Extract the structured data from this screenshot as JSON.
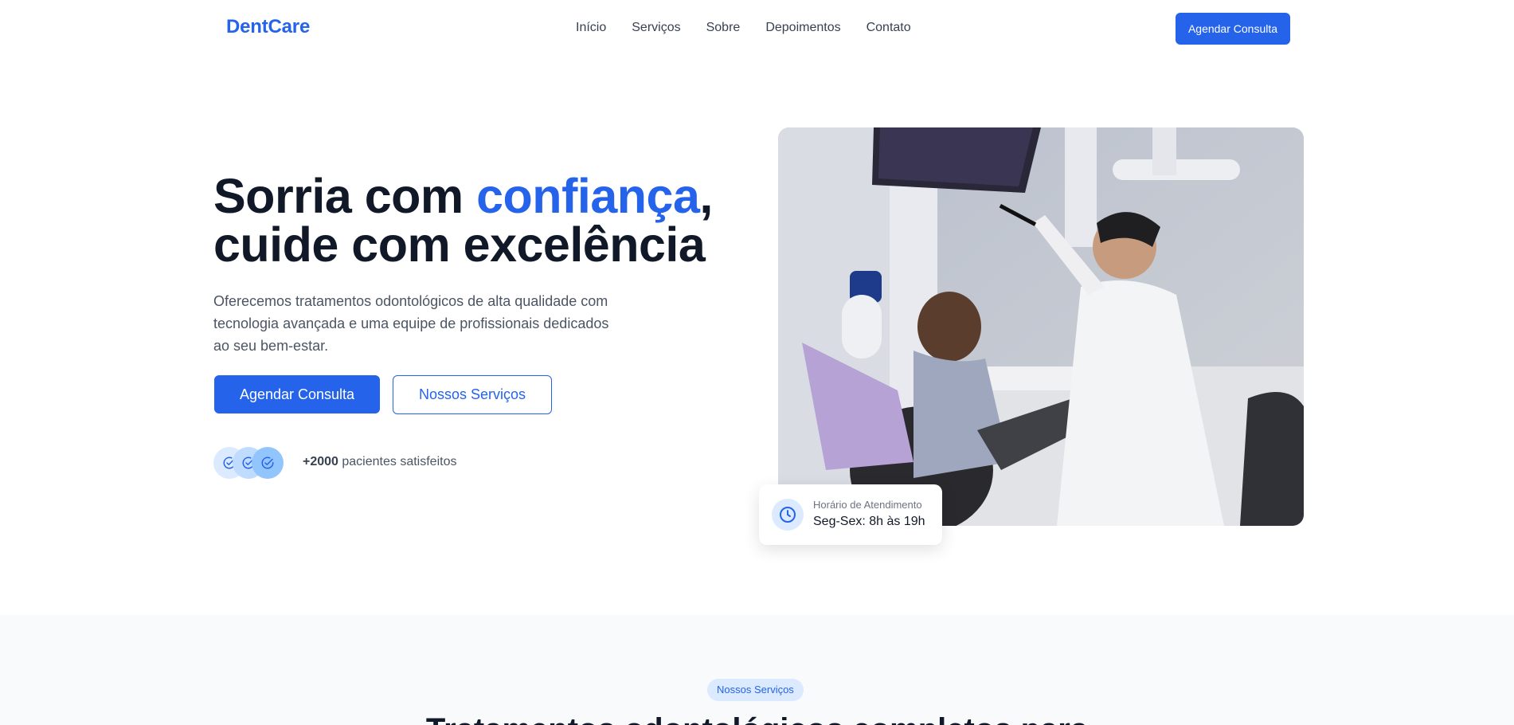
{
  "header": {
    "logo": "DentCare",
    "nav": [
      "Início",
      "Serviços",
      "Sobre",
      "Depoimentos",
      "Contato"
    ],
    "cta": "Agendar Consulta"
  },
  "hero": {
    "title_part1": "Sorria com ",
    "title_accent": "confiança",
    "title_part2": ",",
    "title_line2": "cuide com excelência",
    "description": "Oferecemos tratamentos odontológicos de alta qualidade com tecnologia avançada e uma equipe de profissionais dedicados ao seu bem-estar.",
    "primary_button": "Agendar Consulta",
    "secondary_button": "Nossos Serviços",
    "patients_count": "+2000",
    "patients_label": " pacientes satisfeitos",
    "avatar_icons": [
      "check-circle-icon",
      "check-circle-icon",
      "check-circle-icon"
    ]
  },
  "hours_card": {
    "icon": "clock-icon",
    "label": "Horário de Atendimento",
    "value": "Seg-Sex: 8h às 19h"
  },
  "services": {
    "badge": "Nossos Serviços",
    "title": "Tratamentos odontológicos completos para"
  },
  "colors": {
    "accent": "#2563eb",
    "text_dark": "#111827",
    "text_muted": "#4b5563",
    "accent_light": "#dbeafe",
    "section_bg": "#f9fafb"
  }
}
